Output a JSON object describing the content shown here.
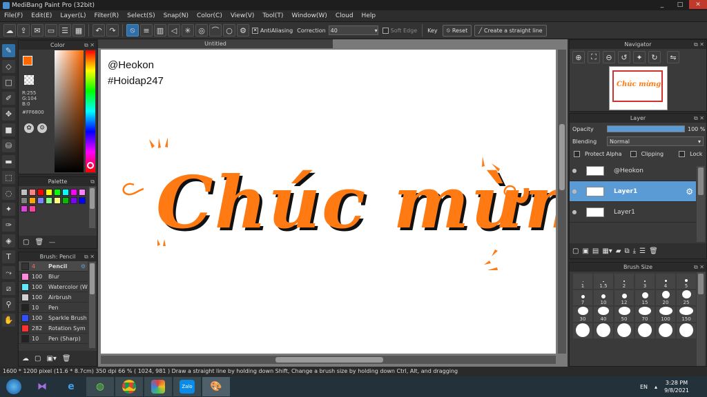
{
  "app": {
    "title": "MediBang Paint Pro (32bit)",
    "win_min": "_",
    "win_max": "□",
    "win_close": "✕"
  },
  "menu": [
    "File(F)",
    "Edit(E)",
    "Layer(L)",
    "Filter(R)",
    "Select(S)",
    "Snap(N)",
    "Color(C)",
    "View(V)",
    "Tool(T)",
    "Window(W)",
    "Cloud",
    "Help"
  ],
  "toolbar": {
    "antialias_label": "AntiAliasing",
    "correction_label": "Correction",
    "correction_value": "40",
    "soft_edge_label": "Soft Edge",
    "key_label": "Key",
    "reset_label": "Reset",
    "straight_line_label": "Create a straight line"
  },
  "color_panel": {
    "title": "Color",
    "r": "R:255",
    "g": "G:104",
    "b": "B:0",
    "hex": "#FF6800",
    "accent": "#ff6800"
  },
  "palette_panel": {
    "title": "Palette",
    "name": "---",
    "swatches": [
      "#c0c0c0",
      "#ff8080",
      "#ff0000",
      "#ffff00",
      "#00ff00",
      "#00ffff",
      "#ff00ff",
      "#ff80ff",
      "#808080",
      "#ffa500",
      "#8080ff",
      "#80ff80",
      "#ffff80",
      "#00c000",
      "#8000ff",
      "#0000ff",
      "#e040e0",
      "#ff40a0"
    ]
  },
  "brush_panel": {
    "title": "Brush: Pencil",
    "items": [
      {
        "size": "4",
        "name": "Pencil",
        "color": "#333333",
        "selected": true
      },
      {
        "size": "100",
        "name": "Blur",
        "color": "#ff88dd"
      },
      {
        "size": "100",
        "name": "Watercolor (W",
        "color": "#60e8ff"
      },
      {
        "size": "100",
        "name": "Airbrush",
        "color": "#d0d0d0"
      },
      {
        "size": "10",
        "name": "Pen",
        "color": "#222222"
      },
      {
        "size": "100",
        "name": "Sparkle Brush",
        "color": "#3050ff"
      },
      {
        "size": "282",
        "name": "Rotation Sym",
        "color": "#ff3030"
      },
      {
        "size": "10",
        "name": "Pen (Sharp)",
        "color": "#222222"
      }
    ]
  },
  "document": {
    "tab": "Untitled",
    "watermark1": "@Heokon",
    "watermark2": "#Hoidap247",
    "lettering": "Chúc mừng",
    "lettering_color": "#ff7a12"
  },
  "navigator": {
    "title": "Navigator"
  },
  "layer_panel": {
    "title": "Layer",
    "opacity_label": "Opacity",
    "opacity_value": "100 %",
    "opacity_fraction": 1.0,
    "blending_label": "Blending",
    "blending_value": "Normal",
    "protect_alpha": "Protect Alpha",
    "clipping": "Clipping",
    "lock": "Lock",
    "layers": [
      {
        "name": "@Heokon",
        "selected": false
      },
      {
        "name": "Layer1",
        "selected": true
      },
      {
        "name": "Layer1",
        "selected": false
      }
    ]
  },
  "brush_size": {
    "title": "Brush Size",
    "sizes": [
      "1",
      "1.5",
      "2",
      "3",
      "4",
      "5",
      "7",
      "10",
      "12",
      "15",
      "20",
      "25",
      "30",
      "40",
      "50",
      "70",
      "100",
      "150",
      "",
      "",
      "",
      "",
      "",
      ""
    ]
  },
  "status": {
    "text": "1600 * 1200 pixel   (11.6 * 8.7cm)   350 dpi   66 %   ( 1024, 981 )   Draw a straight line by holding down Shift, Change a brush size by holding down Ctrl, Alt, and dragging"
  },
  "taskbar": {
    "lang": "EN",
    "time": "3:28 PM",
    "date": "9/8/2021"
  }
}
